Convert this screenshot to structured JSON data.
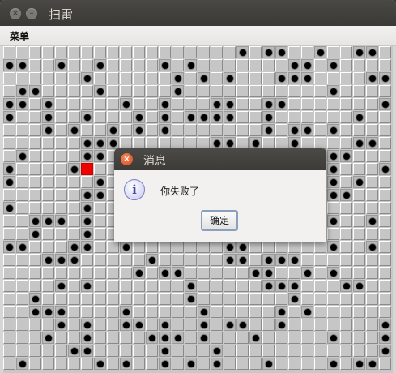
{
  "window": {
    "title": "扫雷"
  },
  "menubar": {
    "menu_label": "菜单"
  },
  "board": {
    "rows": 25,
    "cols": 30,
    "mines": [
      [
        0,
        18
      ],
      [
        0,
        20
      ],
      [
        0,
        21
      ],
      [
        0,
        24
      ],
      [
        0,
        27
      ],
      [
        0,
        28
      ],
      [
        1,
        0
      ],
      [
        1,
        1
      ],
      [
        1,
        4
      ],
      [
        1,
        7
      ],
      [
        1,
        12
      ],
      [
        1,
        14
      ],
      [
        1,
        22
      ],
      [
        1,
        23
      ],
      [
        1,
        25
      ],
      [
        2,
        6
      ],
      [
        2,
        13
      ],
      [
        2,
        15
      ],
      [
        2,
        17
      ],
      [
        2,
        21
      ],
      [
        2,
        22
      ],
      [
        2,
        23
      ],
      [
        2,
        28
      ],
      [
        2,
        29
      ],
      [
        3,
        1
      ],
      [
        3,
        2
      ],
      [
        3,
        7
      ],
      [
        3,
        13
      ],
      [
        3,
        25
      ],
      [
        4,
        0
      ],
      [
        4,
        1
      ],
      [
        4,
        3
      ],
      [
        4,
        9
      ],
      [
        4,
        12
      ],
      [
        4,
        16
      ],
      [
        4,
        17
      ],
      [
        4,
        20
      ],
      [
        4,
        21
      ],
      [
        4,
        29
      ],
      [
        5,
        0
      ],
      [
        5,
        3
      ],
      [
        5,
        6
      ],
      [
        5,
        10
      ],
      [
        5,
        12
      ],
      [
        5,
        14
      ],
      [
        5,
        15
      ],
      [
        5,
        16
      ],
      [
        5,
        17
      ],
      [
        5,
        20
      ],
      [
        5,
        27
      ],
      [
        6,
        3
      ],
      [
        6,
        5
      ],
      [
        6,
        8
      ],
      [
        6,
        10
      ],
      [
        6,
        12
      ],
      [
        6,
        20
      ],
      [
        6,
        22
      ],
      [
        6,
        23
      ],
      [
        6,
        25
      ],
      [
        7,
        6
      ],
      [
        7,
        7
      ],
      [
        7,
        8
      ],
      [
        7,
        16
      ],
      [
        7,
        17
      ],
      [
        7,
        19
      ],
      [
        7,
        22
      ],
      [
        7,
        27
      ],
      [
        7,
        28
      ],
      [
        8,
        1
      ],
      [
        8,
        6
      ],
      [
        8,
        7
      ],
      [
        8,
        25
      ],
      [
        8,
        26
      ],
      [
        9,
        0
      ],
      [
        9,
        5
      ],
      [
        9,
        25
      ],
      [
        9,
        29
      ],
      [
        10,
        0
      ],
      [
        10,
        7
      ],
      [
        10,
        25
      ],
      [
        10,
        27
      ],
      [
        11,
        6
      ],
      [
        11,
        7
      ],
      [
        11,
        25
      ],
      [
        11,
        26
      ],
      [
        12,
        0
      ],
      [
        12,
        6
      ],
      [
        13,
        2
      ],
      [
        13,
        3
      ],
      [
        13,
        4
      ],
      [
        13,
        6
      ],
      [
        13,
        25
      ],
      [
        13,
        28
      ],
      [
        14,
        2
      ],
      [
        14,
        6
      ],
      [
        15,
        0
      ],
      [
        15,
        1
      ],
      [
        15,
        5
      ],
      [
        15,
        6
      ],
      [
        15,
        9
      ],
      [
        15,
        17
      ],
      [
        15,
        18
      ],
      [
        15,
        25
      ],
      [
        15,
        28
      ],
      [
        16,
        3
      ],
      [
        16,
        4
      ],
      [
        16,
        5
      ],
      [
        16,
        11
      ],
      [
        16,
        17
      ],
      [
        16,
        18
      ],
      [
        16,
        20
      ],
      [
        16,
        21
      ],
      [
        16,
        22
      ],
      [
        17,
        10
      ],
      [
        17,
        12
      ],
      [
        17,
        13
      ],
      [
        17,
        19
      ],
      [
        17,
        20
      ],
      [
        17,
        23
      ],
      [
        17,
        25
      ],
      [
        18,
        4
      ],
      [
        18,
        6
      ],
      [
        18,
        14
      ],
      [
        18,
        20
      ],
      [
        18,
        21
      ],
      [
        18,
        22
      ],
      [
        18,
        26
      ],
      [
        18,
        27
      ],
      [
        19,
        2
      ],
      [
        19,
        14
      ],
      [
        19,
        22
      ],
      [
        20,
        2
      ],
      [
        20,
        3
      ],
      [
        20,
        4
      ],
      [
        20,
        9
      ],
      [
        20,
        15
      ],
      [
        20,
        21
      ],
      [
        20,
        23
      ],
      [
        21,
        4
      ],
      [
        21,
        6
      ],
      [
        21,
        9
      ],
      [
        21,
        10
      ],
      [
        21,
        12
      ],
      [
        21,
        15
      ],
      [
        21,
        17
      ],
      [
        21,
        18
      ],
      [
        21,
        21
      ],
      [
        21,
        29
      ],
      [
        22,
        3
      ],
      [
        22,
        6
      ],
      [
        22,
        11
      ],
      [
        22,
        12
      ],
      [
        22,
        13
      ],
      [
        22,
        15
      ],
      [
        22,
        19
      ],
      [
        22,
        25
      ],
      [
        22,
        29
      ],
      [
        23,
        5
      ],
      [
        23,
        6
      ],
      [
        23,
        12
      ],
      [
        23,
        16
      ],
      [
        23,
        29
      ],
      [
        24,
        1
      ],
      [
        24,
        7
      ],
      [
        24,
        9
      ],
      [
        24,
        12
      ],
      [
        24,
        14
      ],
      [
        24,
        16
      ],
      [
        24,
        20
      ],
      [
        24,
        25
      ],
      [
        24,
        27
      ],
      [
        24,
        28
      ]
    ],
    "exploded": [
      9,
      6
    ]
  },
  "dialog": {
    "title": "消息",
    "message": "你失败了",
    "ok_label": "确定",
    "icon": "info-icon"
  }
}
